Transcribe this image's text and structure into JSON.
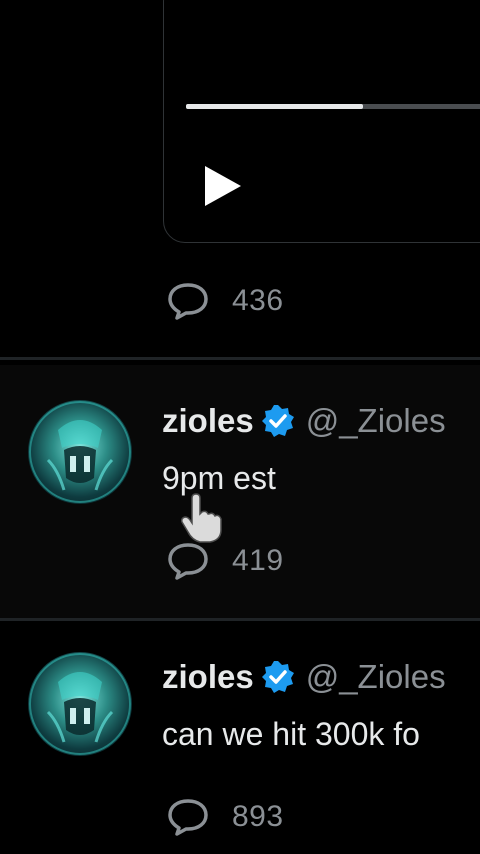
{
  "video": {
    "progress_percent": 59
  },
  "tweets": [
    {
      "stats": {
        "replies": "436"
      }
    },
    {
      "author": {
        "name": "zioles",
        "handle": "@_Zioles"
      },
      "text": "9pm est",
      "stats": {
        "replies": "419"
      }
    },
    {
      "author": {
        "name": "zioles",
        "handle": "@_Zioles"
      },
      "text": "can we hit 300k fo",
      "stats": {
        "replies": "893"
      }
    }
  ],
  "colors": {
    "background": "#000000",
    "text_primary": "#e7e9ea",
    "text_secondary": "#8b9095",
    "verified_badge": "#1d9bf0",
    "avatar_accent": "#2fc7c0"
  },
  "icons": [
    "play-icon",
    "comment-icon",
    "verified-badge-icon",
    "hand-cursor-icon"
  ]
}
